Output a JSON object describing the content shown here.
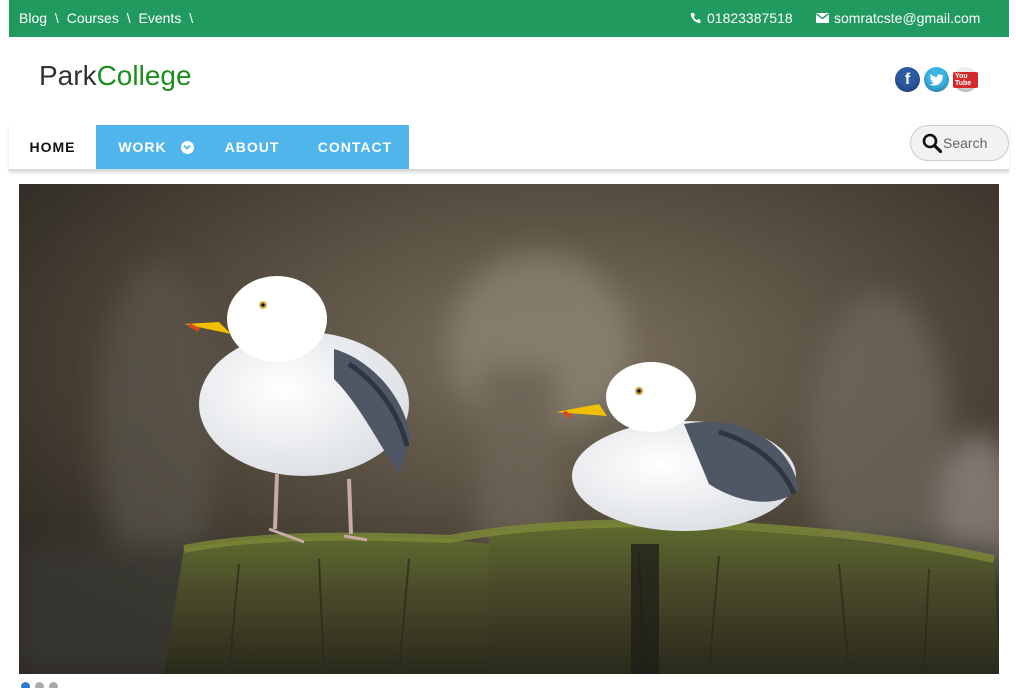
{
  "topbar": {
    "breadcrumbs": [
      {
        "label": "Blog"
      },
      {
        "label": "Courses"
      },
      {
        "label": "Events"
      }
    ],
    "separator": "\\",
    "phone": "01823387518",
    "email": "somratcste@gmail.com",
    "background": "#219a5f"
  },
  "header": {
    "logo_part1": "Park",
    "logo_part2": "College",
    "social": [
      {
        "name": "facebook",
        "glyph": "f",
        "icon": "facebook-icon"
      },
      {
        "name": "twitter",
        "glyph": "t",
        "icon": "twitter-icon"
      },
      {
        "name": "youtube",
        "glyph": "You Tube",
        "icon": "youtube-icon"
      }
    ]
  },
  "nav": {
    "items": [
      {
        "label": "HOME",
        "active": true
      },
      {
        "label": "WORK",
        "has_dropdown": true
      },
      {
        "label": "ABOUT"
      },
      {
        "label": "CONTACT"
      }
    ],
    "accent": "#4fb5ea",
    "search_placeholder": "Search"
  },
  "slider": {
    "slide_count": 3,
    "active_index": 0,
    "image_subject": "two seagulls on a mossy wooden post"
  }
}
